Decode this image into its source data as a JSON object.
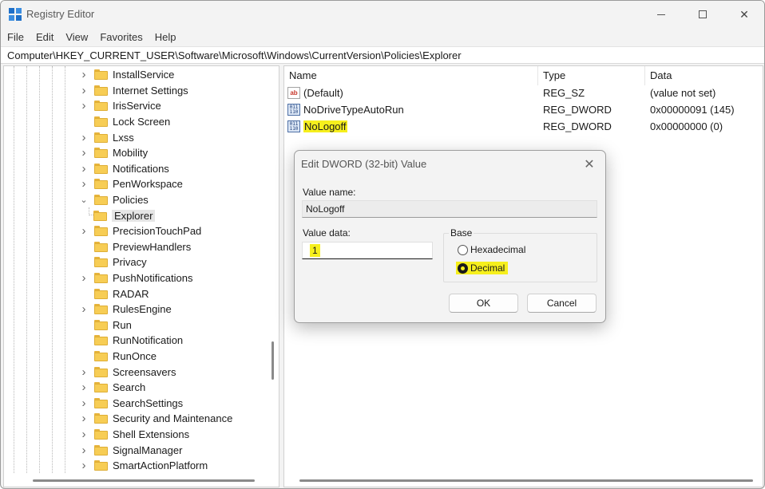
{
  "window": {
    "title": "Registry Editor"
  },
  "menubar": {
    "items": [
      "File",
      "Edit",
      "View",
      "Favorites",
      "Help"
    ]
  },
  "address": {
    "path": "Computer\\HKEY_CURRENT_USER\\Software\\Microsoft\\Windows\\CurrentVersion\\Policies\\Explorer"
  },
  "tree": {
    "items": [
      {
        "label": "InstallService",
        "expandable": true
      },
      {
        "label": "Internet Settings",
        "expandable": true
      },
      {
        "label": "IrisService",
        "expandable": true
      },
      {
        "label": "Lock Screen",
        "expandable": false
      },
      {
        "label": "Lxss",
        "expandable": true
      },
      {
        "label": "Mobility",
        "expandable": true
      },
      {
        "label": "Notifications",
        "expandable": true
      },
      {
        "label": "PenWorkspace",
        "expandable": true
      },
      {
        "label": "Policies",
        "expandable": true,
        "expanded": true
      },
      {
        "label": "Explorer",
        "expandable": false,
        "child": true,
        "selected": true
      },
      {
        "label": "PrecisionTouchPad",
        "expandable": true
      },
      {
        "label": "PreviewHandlers",
        "expandable": false
      },
      {
        "label": "Privacy",
        "expandable": false
      },
      {
        "label": "PushNotifications",
        "expandable": true
      },
      {
        "label": "RADAR",
        "expandable": false
      },
      {
        "label": "RulesEngine",
        "expandable": true
      },
      {
        "label": "Run",
        "expandable": false
      },
      {
        "label": "RunNotification",
        "expandable": false
      },
      {
        "label": "RunOnce",
        "expandable": false
      },
      {
        "label": "Screensavers",
        "expandable": true
      },
      {
        "label": "Search",
        "expandable": true
      },
      {
        "label": "SearchSettings",
        "expandable": true
      },
      {
        "label": "Security and Maintenance",
        "expandable": true
      },
      {
        "label": "Shell Extensions",
        "expandable": true
      },
      {
        "label": "SignalManager",
        "expandable": true
      },
      {
        "label": "SmartActionPlatform",
        "expandable": true
      }
    ]
  },
  "list": {
    "columns": [
      "Name",
      "Type",
      "Data"
    ],
    "rows": [
      {
        "name": "(Default)",
        "type": "REG_SZ",
        "data": "(value not set)",
        "icon": "string-value-icon",
        "highlight": false
      },
      {
        "name": "NoDriveTypeAutoRun",
        "type": "REG_DWORD",
        "data": "0x00000091 (145)",
        "icon": "binary-value-icon",
        "highlight": false
      },
      {
        "name": "NoLogoff",
        "type": "REG_DWORD",
        "data": "0x00000000 (0)",
        "icon": "binary-value-icon",
        "highlight": true
      }
    ]
  },
  "dialog": {
    "title": "Edit DWORD (32-bit) Value",
    "value_name_label": "Value name:",
    "value_name": "NoLogoff",
    "value_data_label": "Value data:",
    "value_data": "1",
    "base_label": "Base",
    "hex_label": "Hexadecimal",
    "dec_label": "Decimal",
    "selected_base": "Decimal",
    "ok_label": "OK",
    "cancel_label": "Cancel"
  },
  "colors": {
    "highlight": "#f6ef1d",
    "folder": "#f7cd55",
    "accent": "#1e6fc8"
  }
}
